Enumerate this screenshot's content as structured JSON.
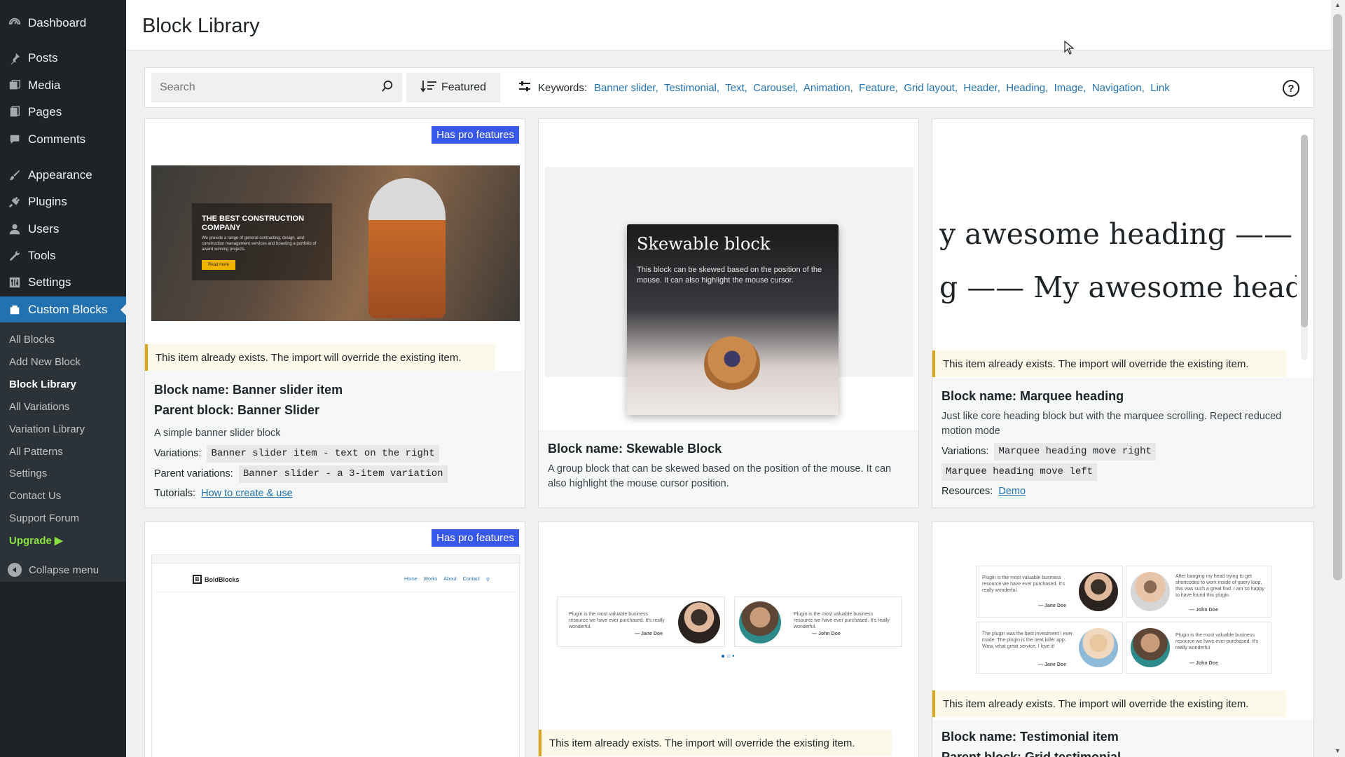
{
  "sidebar": {
    "items": [
      {
        "label": "Dashboard",
        "icon": "dashboard-icon"
      },
      {
        "label": "Posts",
        "icon": "pin-icon"
      },
      {
        "label": "Media",
        "icon": "media-icon"
      },
      {
        "label": "Pages",
        "icon": "pages-icon"
      },
      {
        "label": "Comments",
        "icon": "comment-icon"
      },
      {
        "label": "Appearance",
        "icon": "brush-icon"
      },
      {
        "label": "Plugins",
        "icon": "plug-icon"
      },
      {
        "label": "Users",
        "icon": "user-icon"
      },
      {
        "label": "Tools",
        "icon": "wrench-icon"
      },
      {
        "label": "Settings",
        "icon": "settings-icon"
      },
      {
        "label": "Custom Blocks",
        "icon": "block-icon"
      }
    ],
    "submenu": [
      "All Blocks",
      "Add New Block",
      "Block Library",
      "All Variations",
      "Variation Library",
      "All Patterns",
      "Settings",
      "Contact Us",
      "Support Forum",
      "Upgrade"
    ],
    "collapse": "Collapse menu",
    "current_submenu": "Block Library"
  },
  "header": {
    "title": "Block Library"
  },
  "toolbar": {
    "search_placeholder": "Search",
    "sort_label": "Featured",
    "keywords_label": "Keywords:",
    "keywords": [
      "Banner slider,",
      "Testimonial,",
      "Text,",
      "Carousel,",
      "Animation,",
      "Feature,",
      "Grid layout,",
      "Header,",
      "Heading,",
      "Image,",
      "Navigation,",
      "Link"
    ]
  },
  "notice_text": "This item already exists. The import will override the existing item.",
  "pro_badge": "Has pro features",
  "cards": [
    {
      "name": "Block name: Banner slider item",
      "parent": "Parent block: Banner Slider",
      "desc": "A simple banner slider block",
      "variations_label": "Variations:",
      "variations": [
        "Banner slider item - text on the right"
      ],
      "parent_variations_label": "Parent variations:",
      "parent_variations": [
        "Banner slider - a 3-item variation"
      ],
      "tutorials_label": "Tutorials:",
      "tutorial_link": "How to create & use",
      "preview": {
        "title": "THE BEST CONSTRUCTION COMPANY",
        "text": "We provide a range of general contracting, design, and construction management services and boasting a portfolio of award winning projects.",
        "button": "Read more"
      }
    },
    {
      "name": "Block name: Skewable Block",
      "desc": "A group block that can be skewed based on the position of the mouse. It can also highlight the mouse cursor position.",
      "preview": {
        "title": "Skewable block",
        "text": "This block can be skewed based on the position of the mouse. It can also highlight the mouse cursor."
      }
    },
    {
      "name": "Block name: Marquee heading",
      "desc": "Just like core heading block but with the marquee scrolling. Repect reduced motion mode",
      "variations_label": "Variations:",
      "variations": [
        "Marquee heading move right",
        "Marquee heading move left"
      ],
      "resources_label": "Resources:",
      "resource_link": "Demo",
      "preview": {
        "line1": "y awesome heading  —— My",
        "line2": "g  —— My awesome heading"
      }
    },
    {
      "name": "",
      "preview": {
        "logo": "BoldBlocks",
        "nav": [
          "Home",
          "Works",
          "About",
          "Contact"
        ]
      }
    },
    {
      "name": "",
      "preview": {
        "quote": "Plugin is the most valuable business resource we have ever purchased. It's really wonderful.",
        "author1": "— Jane Doe",
        "author2": "— John Doe"
      }
    },
    {
      "name": "Block name: Testimonial item",
      "parent": "Parent block: Grid testimonial",
      "preview": {
        "q1": "Plugin is the most valuable business resource we have ever purchased. It's really wonderful.",
        "q2": "After banging my head trying to get shortcodes to work inside of query loop, this was such a great find. I am so happy to have found this plugin.",
        "q3": "The plugin was the best investment I ever made. The plugin is the next killer app. Wow, what great service, I love it!",
        "q4": "Plugin is the most valuable business resource we have ever purchased. It's really wonderful.",
        "a1": "— Jane Doe",
        "a2": "— John Doe"
      }
    }
  ],
  "colors": {
    "sidebar": "#1d2327",
    "accent": "#2271b1",
    "badge": "#3858e9",
    "notice_border": "#dba617"
  }
}
